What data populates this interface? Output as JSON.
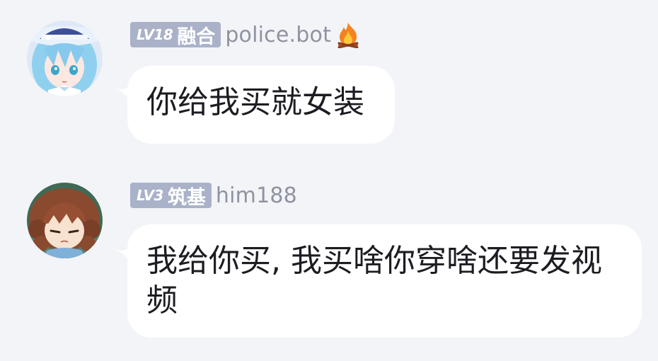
{
  "messages": [
    {
      "level": "LV18",
      "rank": "融合",
      "username": "police.bot",
      "badge_icon": "fire-icon",
      "text": "你给我买就女装",
      "avatar": "blue-hair-girl-avatar"
    },
    {
      "level": "LV3",
      "rank": "筑基",
      "username": "him188",
      "text": "我给你买, 我买啥你穿啥还要发视频",
      "avatar": "brown-hair-girl-avatar"
    }
  ],
  "colors": {
    "background": "#f3f4f8",
    "bubble": "#ffffff",
    "badge": "#a9b2c8",
    "username": "#8f93a0",
    "text": "#1c1c22"
  }
}
